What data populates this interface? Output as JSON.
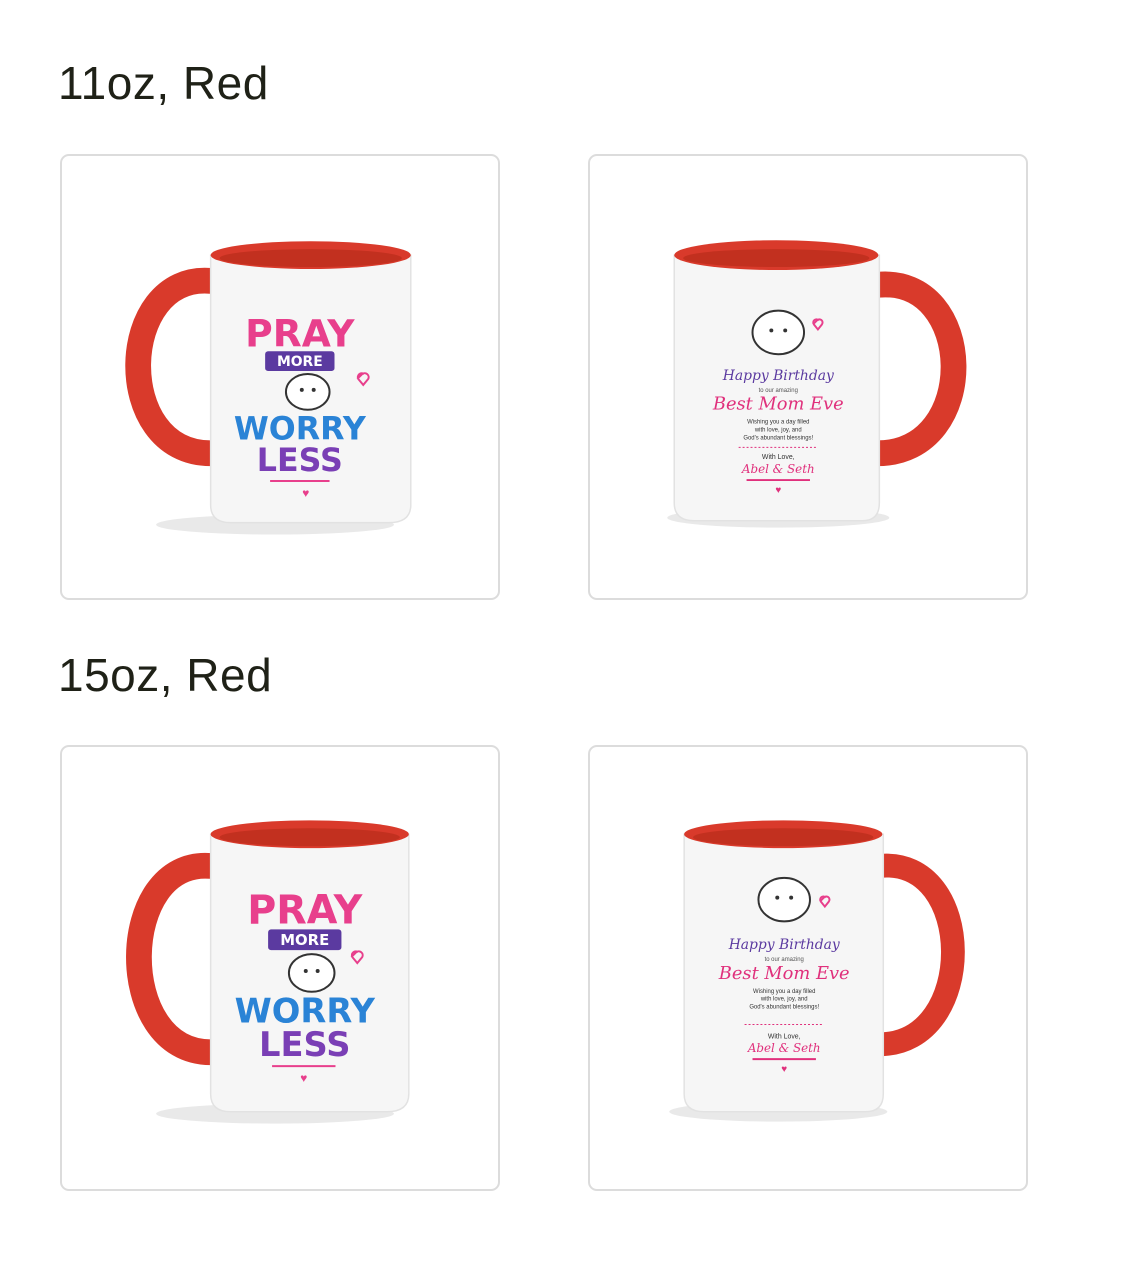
{
  "sections": [
    {
      "title": "11oz, Red",
      "images": [
        {
          "design": "pray-more-worry-less",
          "lines": [
            "PRAY",
            "MORE",
            "WORRY",
            "LESS"
          ]
        },
        {
          "design": "birthday-message",
          "lines": [
            "Happy Birthday",
            "to our amazing",
            "Best Mom Eve",
            "Wishing you a day filled",
            "with love, joy, and",
            "God's abundant blessings!",
            "With Love,",
            "Abel & Seth"
          ]
        }
      ]
    },
    {
      "title": "15oz, Red",
      "images": [
        {
          "design": "pray-more-worry-less",
          "lines": [
            "PRAY",
            "MORE",
            "WORRY",
            "LESS"
          ]
        },
        {
          "design": "birthday-message",
          "lines": [
            "Happy Birthday",
            "to our amazing",
            "Best Mom Eve",
            "Wishing you a day filled",
            "with love, joy, and",
            "God's abundant blessings!",
            "With Love,",
            "Abel & Seth"
          ]
        }
      ]
    }
  ],
  "colors": {
    "mug_accent": "#d93a2b",
    "mug_body": "#f6f6f6",
    "pray": "#e83f8c",
    "more_banner": "#5b3aa0",
    "worry": "#2a83d6",
    "less": "#7a3fb5",
    "birthday_purple": "#5b3aa0",
    "best_mom_pink": "#e0307c"
  }
}
